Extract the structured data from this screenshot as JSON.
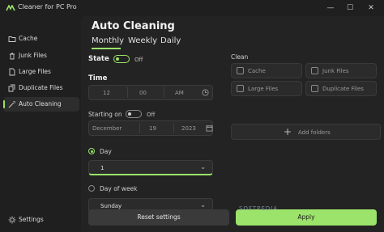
{
  "window": {
    "title": "Cleaner for PC Pro",
    "minimize": "—",
    "maximize": "☐",
    "close": "✕"
  },
  "sidebar": {
    "items": [
      {
        "label": "Cache"
      },
      {
        "label": "Junk Files"
      },
      {
        "label": "Large Files"
      },
      {
        "label": "Duplicate Files"
      },
      {
        "label": "Auto Cleaning"
      }
    ],
    "settings_label": "Settings"
  },
  "main": {
    "title": "Auto Cleaning",
    "tabs": [
      "Monthly",
      "Weekly",
      "Daily"
    ],
    "state": {
      "label": "State",
      "toggle": "Off",
      "on": false
    },
    "time": {
      "label": "Time",
      "hour": "12",
      "minute": "00",
      "ampm": "AM"
    },
    "starting_on": {
      "label": "Starting on",
      "toggle": "Off",
      "month": "December",
      "day": "19",
      "year": "2023"
    },
    "day_option": {
      "label": "Day",
      "value": "1"
    },
    "day_of_week_option": {
      "label": "Day of week",
      "value": "Sunday"
    },
    "clean": {
      "label": "Clean",
      "options": [
        "Cache",
        "Junk Files",
        "Large Files",
        "Duplicate Files"
      ],
      "add_folders": "Add folders"
    },
    "buttons": {
      "reset": "Reset settings",
      "apply": "Apply"
    }
  },
  "watermark": "SOFTPEDIA",
  "colors": {
    "accent": "#9be36a",
    "background": "#1f1f1f",
    "panel": "#232323"
  }
}
